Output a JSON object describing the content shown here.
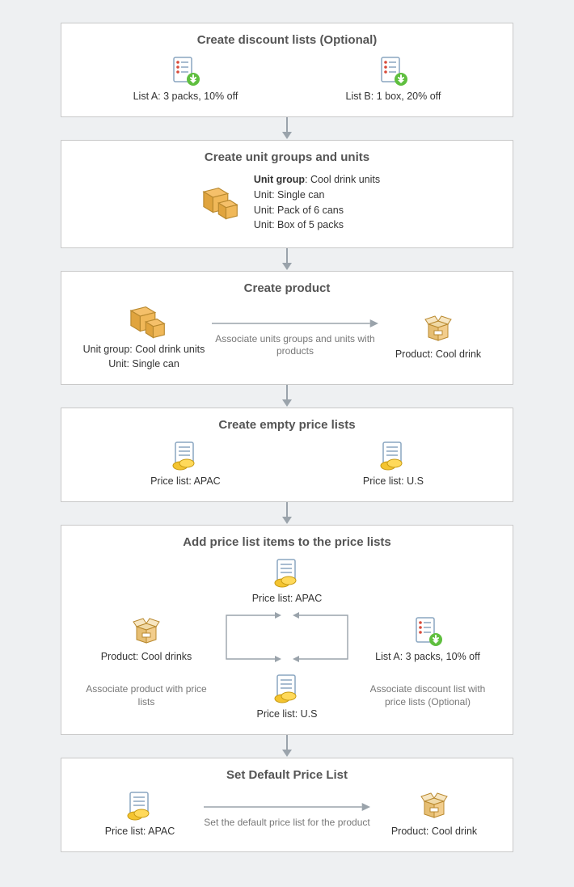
{
  "panels": {
    "p1": {
      "title": "Create discount lists (Optional)",
      "listA": "List A: 3 packs, 10% off",
      "listB": "List B: 1 box, 20% off"
    },
    "p2": {
      "title": "Create unit groups and units",
      "groupLabel": "Unit group",
      "groupValue": ": Cool drink units",
      "u1": "Unit: Single can",
      "u2": "Unit: Pack of 6 cans",
      "u3": "Unit: Box of 5 packs"
    },
    "p3": {
      "title": "Create product",
      "leftL1": "Unit group: Cool drink units",
      "leftL2": "Unit: Single can",
      "arrowLabel": "Associate units groups and units with products",
      "right": "Product: Cool drink"
    },
    "p4": {
      "title": "Create empty price lists",
      "left": "Price list: APAC",
      "right": "Price list: U.S"
    },
    "p5": {
      "title": "Add price list items to the price lists",
      "product": "Product: Cool drinks",
      "plApac": "Price list: APAC",
      "plUs": "Price list: U.S",
      "listA": "List A: 3 packs, 10% off",
      "leftNote": "Associate product with price lists",
      "rightNote": "Associate discount list with price lists (Optional)"
    },
    "p6": {
      "title": "Set Default Price List",
      "left": "Price list: APAC",
      "arrowLabel": "Set the default price list for the product",
      "right": "Product: Cool drink"
    }
  }
}
